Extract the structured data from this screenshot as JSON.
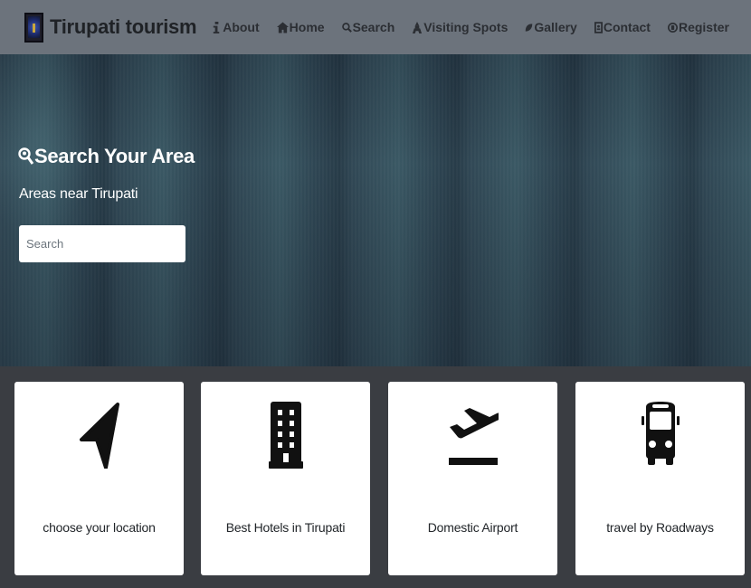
{
  "brand": {
    "title": "Tirupati tourism"
  },
  "nav": {
    "items": [
      {
        "label": "About",
        "icon": "info-icon"
      },
      {
        "label": "Home",
        "icon": "home-icon"
      },
      {
        "label": "Search",
        "icon": "search-icon"
      },
      {
        "label": "Visiting Spots",
        "icon": "landmark-icon"
      },
      {
        "label": "Gallery",
        "icon": "leaf-icon"
      },
      {
        "label": "Contact",
        "icon": "contact-card-icon"
      },
      {
        "label": "Register",
        "icon": "register-icon"
      }
    ]
  },
  "hero": {
    "title": "Search Your Area",
    "subtitle": "Areas near Tirupati",
    "search_placeholder": "Search"
  },
  "cards": [
    {
      "label": "choose your location",
      "icon": "location-arrow-icon"
    },
    {
      "label": "Best Hotels in Tirupati",
      "icon": "hotel-building-icon"
    },
    {
      "label": "Domestic Airport",
      "icon": "plane-departure-icon"
    },
    {
      "label": "travel by Roadways",
      "icon": "bus-icon"
    }
  ],
  "colors": {
    "navbar_bg": "#6c737c",
    "nav_text": "#2b2e33",
    "page_bg": "#3a3d42",
    "card_bg": "#ffffff",
    "hero_text": "#ffffff"
  }
}
